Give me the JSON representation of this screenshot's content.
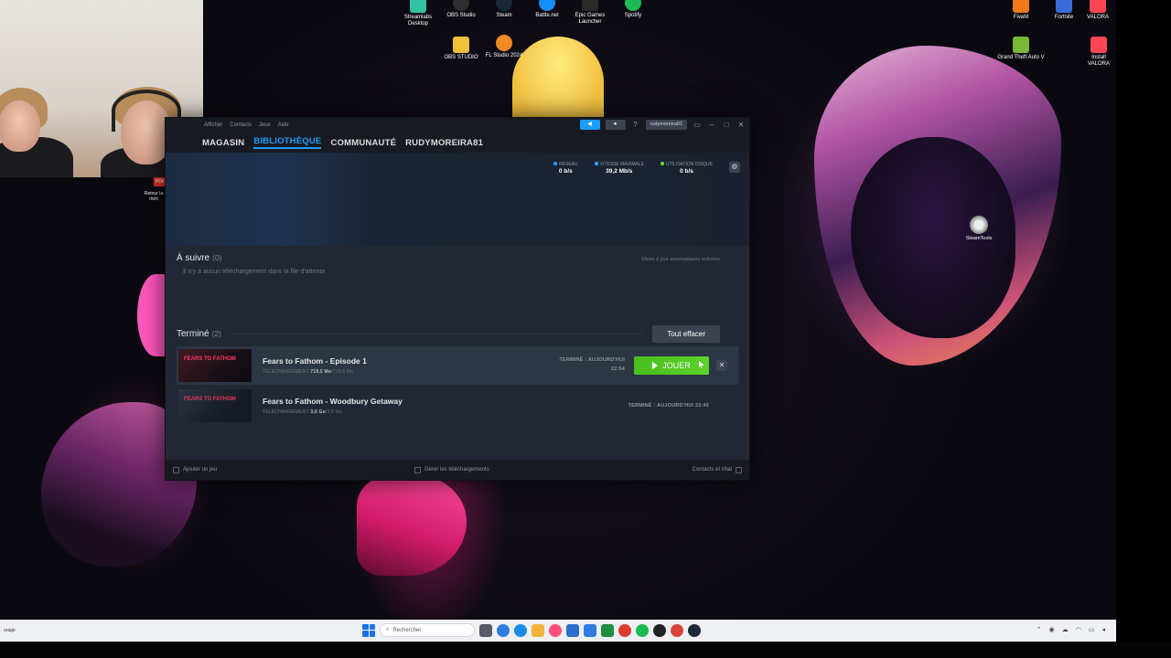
{
  "desktop": {
    "top_icons": [
      {
        "label": "Streamlabs Desktop",
        "color": "#31c3a2"
      },
      {
        "label": "OBS Studio",
        "color": "#302e31"
      },
      {
        "label": "Steam",
        "color": "#1b2838"
      },
      {
        "label": "Battle.net",
        "color": "#148eff"
      },
      {
        "label": "Epic Games Launcher",
        "color": "#2a2a2a"
      },
      {
        "label": "Spotify",
        "color": "#1db954"
      }
    ],
    "second_icons": [
      {
        "label": "OBS STUDIO",
        "color": "#f0c23c"
      },
      {
        "label": "FL Studio 2024",
        "color": "#f08a24"
      }
    ],
    "right_icons": [
      {
        "label": "FiveM",
        "color": "#f07a1a"
      },
      {
        "label": "Fortnite",
        "color": "#3a6ad8"
      },
      {
        "label": "VALORA",
        "color": "#ff4655"
      },
      {
        "label": "Grand Theft Auto V",
        "color": "#7ab83a"
      },
      {
        "label": "Install VALORA",
        "color": "#ff4655"
      }
    ],
    "steamtools_label": "SteamTools",
    "webcam_caption": "Retour la méti",
    "webcam_badge": "PDF"
  },
  "steam": {
    "menu": [
      "Afficher",
      "Contacts",
      "Jeux",
      "Aide"
    ],
    "username_chip": "rudymoreira81",
    "nav": [
      {
        "label": "MAGASIN",
        "active": false
      },
      {
        "label": "BIBLIOTHÈQUE",
        "active": true
      },
      {
        "label": "COMMUNAUTÉ",
        "active": false
      },
      {
        "label": "RUDYMOREIRA81",
        "active": false
      }
    ],
    "stats": {
      "network_label": "RÉSEAU",
      "network_value": "0 b/s",
      "max_speed_label": "VITESSE MAXIMALE",
      "max_speed_value": "39,2 Mb/s",
      "disk_label": "UTILISATION DISQUE",
      "disk_value": "0 b/s"
    },
    "queue": {
      "title": "À suivre",
      "count": "(0)",
      "empty_message": "Il n'y a aucun téléchargement dans la file d'attente",
      "auto_updates": "Mises à jour automatiques activées"
    },
    "completed": {
      "title": "Terminé",
      "count": "(2)",
      "clear_all": "Tout effacer",
      "items": [
        {
          "name": "Fears to Fathom - Episode 1",
          "thumb_text": "FEARS TO FATHOM",
          "sub_label": "TÉLÉCHARGEMENT",
          "downloaded": "719,5 Mo",
          "total": "/719,5 Mo",
          "status_line1": "TERMINÉ : AUJOURD'HUI",
          "status_line2": "22:54",
          "play_label": "JOUER"
        },
        {
          "name": "Fears to Fathom - Woodbury Getaway",
          "thumb_text": "FEARS TO FATHOM",
          "sub_label": "TÉLÉCHARGEMENT",
          "downloaded": "3,6 Go",
          "total": "/3,6 Go",
          "status_line1": "TERMINÉ : AUJOURD'HUI 22:45"
        }
      ]
    },
    "bottom": {
      "add_game": "Ajouter un jeu",
      "manage_downloads": "Gérer les téléchargements",
      "friends_chat": "Contacts et chat"
    }
  },
  "taskbar": {
    "search_placeholder": "Rechercher",
    "weather": "orage",
    "apps": [
      "#555a66",
      "#2f7de1",
      "#1a8ce8",
      "#f3b33c",
      "#ff4f7a",
      "#2b6fc9",
      "#2f7de1",
      "#1e8f3f",
      "#de3d2d",
      "#1db954",
      "#222222",
      "#d8443c",
      "#1b2838"
    ]
  }
}
